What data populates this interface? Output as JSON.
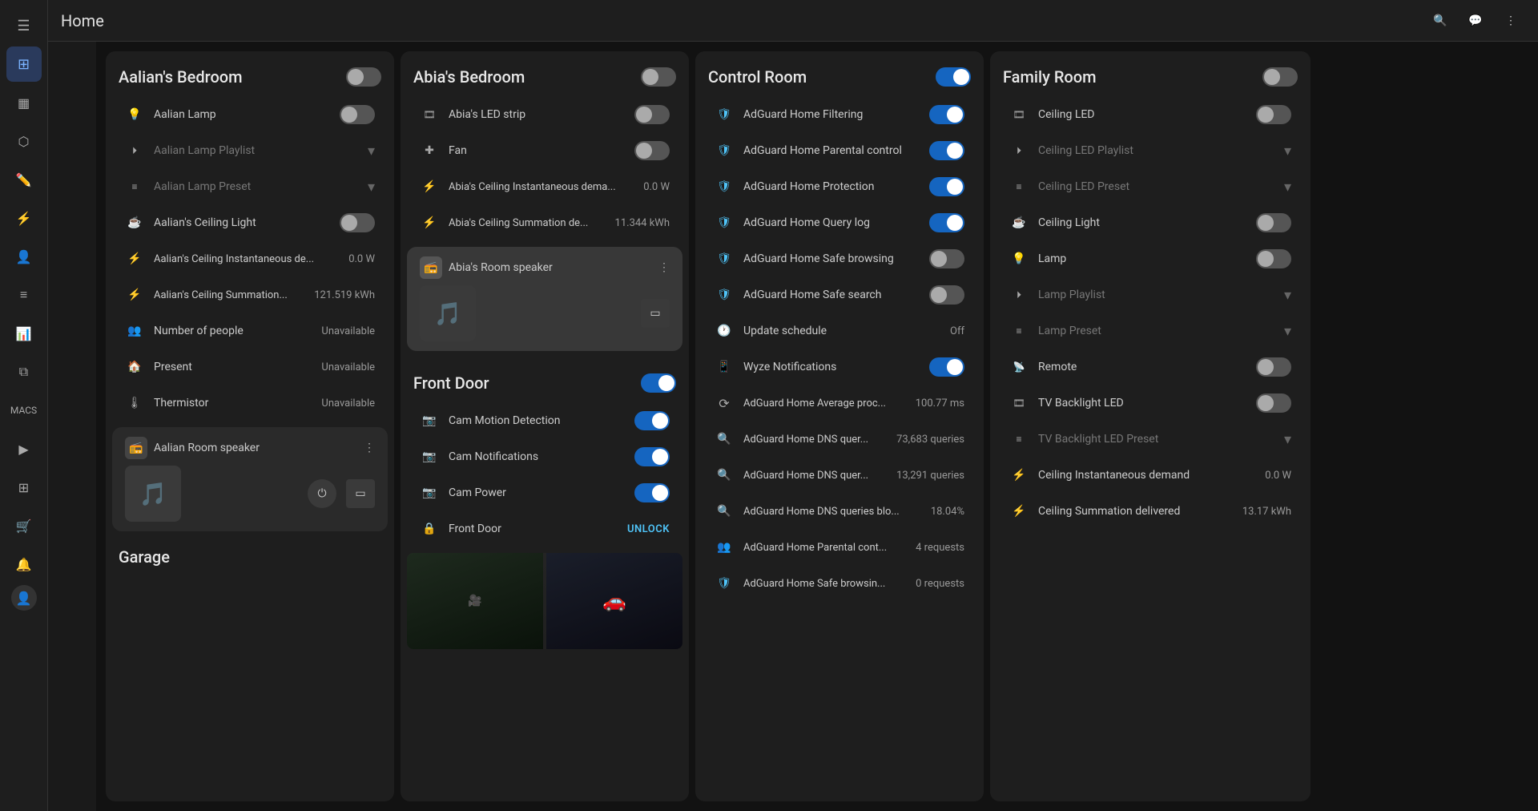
{
  "app": {
    "title": "Home"
  },
  "sidebar": {
    "items": [
      {
        "id": "menu",
        "icon": "☰",
        "active": false
      },
      {
        "id": "dashboard",
        "icon": "⊞",
        "active": true
      },
      {
        "id": "widgets",
        "icon": "▦",
        "active": false
      },
      {
        "id": "entity",
        "icon": "⬡",
        "active": false
      },
      {
        "id": "pencil",
        "icon": "✎",
        "active": false
      },
      {
        "id": "lightning",
        "icon": "⚡",
        "active": false
      },
      {
        "id": "person",
        "icon": "👤",
        "active": false
      },
      {
        "id": "list",
        "icon": "≡",
        "active": false
      },
      {
        "id": "chart",
        "icon": "📊",
        "active": false
      },
      {
        "id": "layers",
        "icon": "⧉",
        "active": false
      },
      {
        "id": "macs",
        "icon": "⊟",
        "active": false
      },
      {
        "id": "play",
        "icon": "▶",
        "active": false
      },
      {
        "id": "dashboard2",
        "icon": "⊞",
        "active": false
      },
      {
        "id": "store",
        "icon": "🛒",
        "active": false
      },
      {
        "id": "bell",
        "icon": "🔔",
        "active": false
      },
      {
        "id": "user",
        "icon": "👤",
        "active": false
      }
    ]
  },
  "topbar": {
    "title": "Home",
    "search_icon": "🔍",
    "chat_icon": "💬",
    "more_icon": "⋮"
  },
  "rooms": {
    "aalians_bedroom": {
      "title": "Aalian's Bedroom",
      "toggle_on": false,
      "devices": [
        {
          "id": "aalian-lamp",
          "icon": "💡",
          "name": "Aalian Lamp",
          "value": "",
          "toggle": true,
          "toggle_on": false,
          "has_chevron": false
        },
        {
          "id": "aalian-lamp-playlist",
          "icon": "⏵",
          "name": "Aalian Lamp Playlist",
          "value": "",
          "toggle": false,
          "toggle_on": false,
          "has_chevron": true,
          "dim": true
        },
        {
          "id": "aalian-lamp-preset",
          "icon": "≡",
          "name": "Aalian Lamp Preset",
          "value": "",
          "toggle": false,
          "toggle_on": false,
          "has_chevron": true,
          "dim": true
        },
        {
          "id": "aalians-ceiling-light",
          "icon": "☕",
          "name": "Aalian's Ceiling Light",
          "value": "",
          "toggle": true,
          "toggle_on": false,
          "has_chevron": false
        },
        {
          "id": "aalians-ceiling-instantaneous",
          "icon": "⚡",
          "name": "Aalian's Ceiling Instantaneous de...",
          "value": "0.0 W",
          "toggle": false,
          "toggle_on": false,
          "has_chevron": false
        },
        {
          "id": "aalians-ceiling-summation",
          "icon": "⚡",
          "name": "Aalian's Ceiling Summation...",
          "value": "121.519 kWh",
          "toggle": false,
          "toggle_on": false,
          "has_chevron": false
        },
        {
          "id": "number-of-people",
          "icon": "👥",
          "name": "Number of people",
          "value": "Unavailable",
          "toggle": false,
          "toggle_on": false,
          "has_chevron": false
        },
        {
          "id": "present",
          "icon": "🏠",
          "name": "Present",
          "value": "Unavailable",
          "toggle": false,
          "toggle_on": false,
          "has_chevron": false
        },
        {
          "id": "thermistor",
          "icon": "🌡",
          "name": "Thermistor",
          "value": "Unavailable",
          "toggle": false,
          "toggle_on": false,
          "has_chevron": false
        }
      ],
      "speaker": {
        "name": "Aalian Room speaker",
        "icon": "📻"
      }
    },
    "abias_bedroom": {
      "title": "Abia's Bedroom",
      "toggle_on": false,
      "devices": [
        {
          "id": "abias-led-strip",
          "icon": "🎞",
          "name": "Abia's LED strip",
          "value": "",
          "toggle": true,
          "toggle_on": false,
          "has_chevron": false
        },
        {
          "id": "fan",
          "icon": "✚",
          "name": "Fan",
          "value": "",
          "toggle": true,
          "toggle_on": false,
          "has_chevron": false
        },
        {
          "id": "abias-ceiling-instantaneous",
          "icon": "⚡",
          "name": "Abia's Ceiling Instantaneous dema...",
          "value": "0.0 W",
          "toggle": false,
          "toggle_on": false,
          "has_chevron": false
        },
        {
          "id": "abias-ceiling-summation",
          "icon": "⚡",
          "name": "Abia's Ceiling Summation de...",
          "value": "11.344 kWh",
          "toggle": false,
          "toggle_on": false,
          "has_chevron": false
        }
      ],
      "speaker": {
        "name": "Abia's Room speaker",
        "icon": "📻"
      }
    },
    "control_room": {
      "title": "Control Room",
      "toggle_on": true,
      "devices": [
        {
          "id": "adguard-filtering",
          "icon": "🛡",
          "name": "AdGuard Home Filtering",
          "value": "",
          "toggle": true,
          "toggle_on": true,
          "has_chevron": false
        },
        {
          "id": "adguard-parental",
          "icon": "🛡",
          "name": "AdGuard Home Parental control",
          "value": "",
          "toggle": true,
          "toggle_on": true,
          "has_chevron": false
        },
        {
          "id": "adguard-protection",
          "icon": "🛡",
          "name": "AdGuard Home Protection",
          "value": "",
          "toggle": true,
          "toggle_on": true,
          "has_chevron": false
        },
        {
          "id": "adguard-query-log",
          "icon": "🛡",
          "name": "AdGuard Home Query log",
          "value": "",
          "toggle": true,
          "toggle_on": true,
          "has_chevron": false
        },
        {
          "id": "adguard-safe-browsing",
          "icon": "🛡",
          "name": "AdGuard Home Safe browsing",
          "value": "",
          "toggle": true,
          "toggle_on": false,
          "has_chevron": false
        },
        {
          "id": "adguard-safe-search",
          "icon": "🛡",
          "name": "AdGuard Home Safe search",
          "value": "",
          "toggle": true,
          "toggle_on": false,
          "has_chevron": false
        },
        {
          "id": "update-schedule",
          "icon": "🕐",
          "name": "Update schedule",
          "value": "Off",
          "toggle": false,
          "toggle_on": false,
          "has_chevron": false
        },
        {
          "id": "wyze-notifications",
          "icon": "📱",
          "name": "Wyze Notifications",
          "value": "",
          "toggle": true,
          "toggle_on": true,
          "has_chevron": false
        },
        {
          "id": "adguard-average-proc",
          "icon": "⟳",
          "name": "AdGuard Home Average proc...",
          "value": "100.77 ms",
          "toggle": false,
          "toggle_on": false,
          "has_chevron": false
        },
        {
          "id": "adguard-dns-queries",
          "icon": "🔍",
          "name": "AdGuard Home DNS quer...",
          "value": "73,683 queries",
          "toggle": false,
          "toggle_on": false,
          "has_chevron": false
        },
        {
          "id": "adguard-dns-queries2",
          "icon": "🔍",
          "name": "AdGuard Home DNS quer...",
          "value": "13,291 queries",
          "toggle": false,
          "toggle_on": false,
          "has_chevron": false
        },
        {
          "id": "adguard-dns-blocked",
          "icon": "🔍",
          "name": "AdGuard Home DNS queries blo...",
          "value": "18.04%",
          "toggle": false,
          "toggle_on": false,
          "has_chevron": false
        },
        {
          "id": "adguard-parental-cont",
          "icon": "👥",
          "name": "AdGuard Home Parental cont...",
          "value": "4 requests",
          "toggle": false,
          "toggle_on": false,
          "has_chevron": false
        },
        {
          "id": "adguard-safe-browsin",
          "icon": "🛡",
          "name": "AdGuard Home Safe browsin...",
          "value": "0 requests",
          "toggle": false,
          "toggle_on": false,
          "has_chevron": false
        }
      ]
    },
    "front_door": {
      "title": "Front Door",
      "toggle_on": true,
      "devices": [
        {
          "id": "cam-motion-detection",
          "icon": "📷",
          "name": "Cam Motion Detection",
          "value": "",
          "toggle": true,
          "toggle_on": true,
          "has_chevron": false
        },
        {
          "id": "cam-notifications",
          "icon": "📷",
          "name": "Cam Notifications",
          "value": "",
          "toggle": true,
          "toggle_on": true,
          "has_chevron": false
        },
        {
          "id": "cam-power",
          "icon": "📷",
          "name": "Cam Power",
          "value": "",
          "toggle": true,
          "toggle_on": true,
          "has_chevron": false
        },
        {
          "id": "front-door-lock",
          "icon": "🔒",
          "name": "Front Door",
          "value": "UNLOCK",
          "toggle": false,
          "toggle_on": false,
          "has_chevron": false,
          "is_unlock": true
        }
      ],
      "has_camera_image": true
    },
    "family_room": {
      "title": "Family Room",
      "toggle_on": false,
      "devices": [
        {
          "id": "ceiling-led",
          "icon": "🎞",
          "name": "Ceiling LED",
          "value": "",
          "toggle": true,
          "toggle_on": false,
          "has_chevron": false
        },
        {
          "id": "ceiling-led-playlist",
          "icon": "⏵",
          "name": "Ceiling LED Playlist",
          "value": "",
          "toggle": false,
          "toggle_on": false,
          "has_chevron": true,
          "dim": true
        },
        {
          "id": "ceiling-led-preset",
          "icon": "≡",
          "name": "Ceiling LED Preset",
          "value": "",
          "toggle": false,
          "toggle_on": false,
          "has_chevron": true,
          "dim": true
        },
        {
          "id": "ceiling-light",
          "icon": "☕",
          "name": "Ceiling Light",
          "value": "",
          "toggle": true,
          "toggle_on": false,
          "has_chevron": false
        },
        {
          "id": "lamp",
          "icon": "💡",
          "name": "Lamp",
          "value": "",
          "toggle": true,
          "toggle_on": false,
          "has_chevron": false
        },
        {
          "id": "lamp-playlist",
          "icon": "⏵",
          "name": "Lamp Playlist",
          "value": "",
          "toggle": false,
          "toggle_on": false,
          "has_chevron": true,
          "dim": true
        },
        {
          "id": "lamp-preset",
          "icon": "≡",
          "name": "Lamp Preset",
          "value": "",
          "toggle": false,
          "toggle_on": false,
          "has_chevron": true,
          "dim": true
        },
        {
          "id": "remote",
          "icon": "📡",
          "name": "Remote",
          "value": "",
          "toggle": true,
          "toggle_on": false,
          "has_chevron": false
        },
        {
          "id": "tv-backlight-led",
          "icon": "🎞",
          "name": "TV Backlight LED",
          "value": "",
          "toggle": true,
          "toggle_on": false,
          "has_chevron": false
        },
        {
          "id": "tv-backlight-led-preset",
          "icon": "≡",
          "name": "TV Backlight LED Preset",
          "value": "",
          "toggle": false,
          "toggle_on": false,
          "has_chevron": true,
          "dim": true
        },
        {
          "id": "ceiling-instantaneous",
          "icon": "⚡",
          "name": "Ceiling Instantaneous demand",
          "value": "0.0 W",
          "toggle": false,
          "toggle_on": false,
          "has_chevron": false
        },
        {
          "id": "ceiling-summation",
          "icon": "⚡",
          "name": "Ceiling Summation delivered",
          "value": "13.17 kWh",
          "toggle": false,
          "toggle_on": false,
          "has_chevron": false
        }
      ]
    },
    "garage": {
      "title": "Garage"
    }
  }
}
